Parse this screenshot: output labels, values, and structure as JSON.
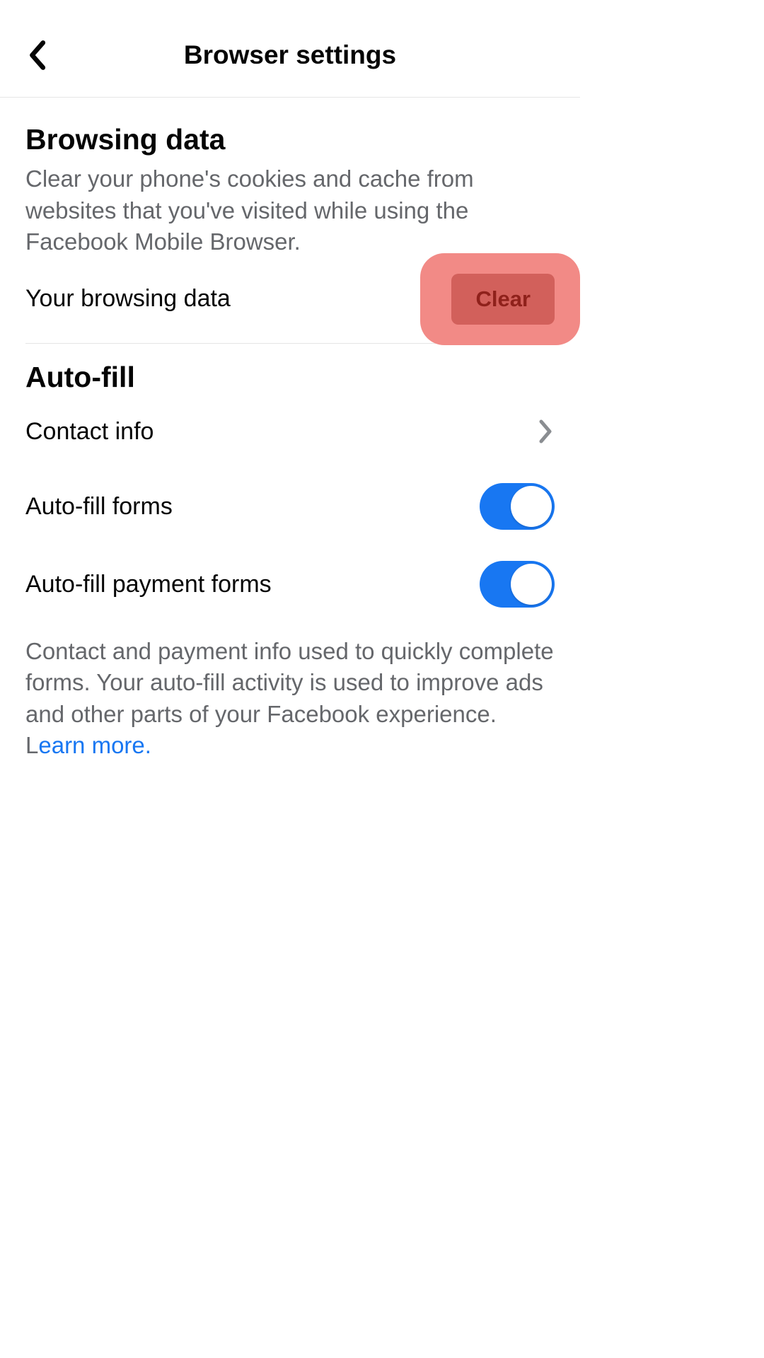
{
  "statusBar": {
    "time": "",
    "carrier": ""
  },
  "header": {
    "title": "Browser settings"
  },
  "browsingData": {
    "title": "Browsing data",
    "description": "Clear your phone's cookies and cache from websites that you've visited while using the Facebook Mobile Browser.",
    "rowLabel": "Your browsing data",
    "clearLabel": "Clear"
  },
  "autoFill": {
    "title": "Auto-fill",
    "contactLabel": "Contact info",
    "formsLabel": "Auto-fill forms",
    "formsOn": true,
    "paymentLabel": "Auto-fill payment forms",
    "paymentOn": true,
    "footerPart1": "Contact and payment info used to quickly complete forms. Your auto-fill activity is used to improve ads and other parts of your Facebook experience. L",
    "learnMore": "earn more."
  }
}
